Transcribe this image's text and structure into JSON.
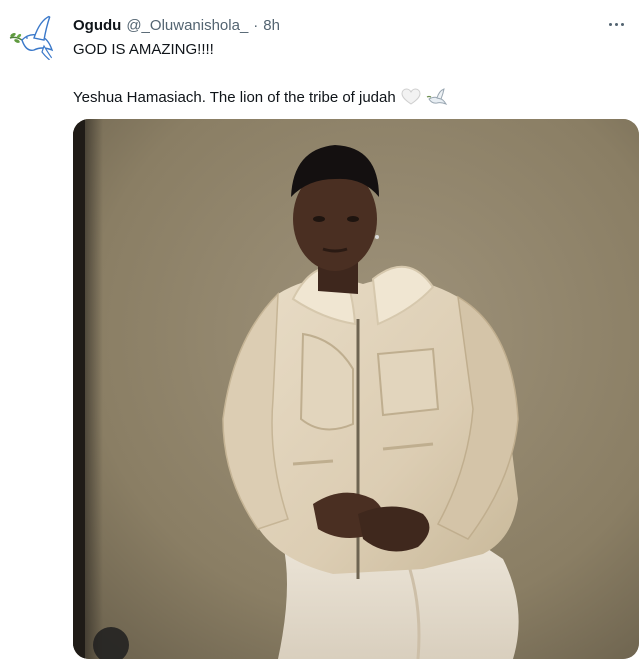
{
  "tweet": {
    "display_name": "Ogudu",
    "handle": "@_Oluwanishola_",
    "separator": "·",
    "timestamp": "8h",
    "text_line1": "GOD IS AMAZING!!!!",
    "text_line2": "Yeshua Hamasiach.  The lion of the tribe of judah",
    "emojis": [
      "white-heart-icon",
      "dove-icon"
    ]
  },
  "avatar": {
    "icon": "dove-with-olive-branch-icon",
    "accent": "#3a78c9"
  },
  "more_icon": "more-options-icon",
  "media": {
    "icon": "photo-of-man-in-shearling-jacket"
  },
  "colors": {
    "text_primary": "#0f1419",
    "text_secondary": "#536471",
    "photo_background": "#8f8368"
  }
}
